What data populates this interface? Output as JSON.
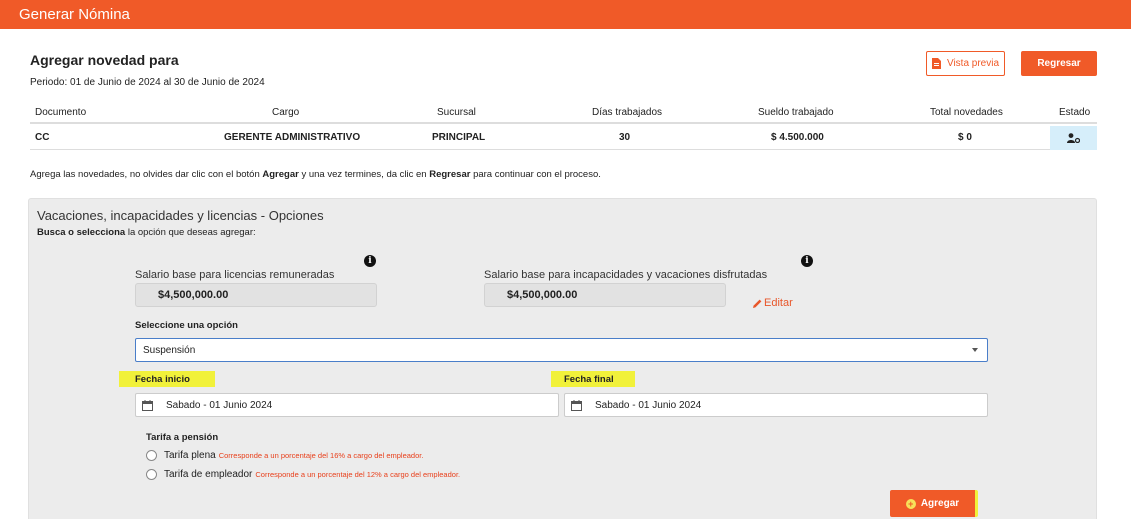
{
  "header": {
    "title": "Generar Nómina"
  },
  "page": {
    "title": "Agregar novedad para",
    "period": "Periodo: 01 de Junio de 2024 al 30 de Junio de 2024"
  },
  "toolbar": {
    "preview_label": "Vista previa",
    "back_label": "Regresar"
  },
  "table": {
    "columns": {
      "documento": "Documento",
      "cargo": "Cargo",
      "sucursal": "Sucursal",
      "dias": "Días trabajados",
      "sueldo": "Sueldo trabajado",
      "novedades": "Total novedades",
      "estado": "Estado"
    },
    "row": {
      "documento": "CC",
      "cargo": "GERENTE ADMINISTRATIVO",
      "sucursal": "PRINCIPAL",
      "dias": "30",
      "sueldo": "$ 4.500.000",
      "novedades": "$ 0"
    }
  },
  "hint": {
    "part1": "Agrega las novedades, no olvides dar clic con el botón ",
    "bold1": "Agregar",
    "part2": " y una vez termines, da clic en ",
    "bold2": "Regresar",
    "part3": " para continuar con el proceso."
  },
  "panel": {
    "title": "Vacaciones, incapacidades y licencias - Opciones",
    "sub_bold": "Busca o selecciona",
    "sub_rest": " la opción que deseas agregar:",
    "salary_licencias_label": "Salario base para licencias remuneradas",
    "salary_licencias_value": "$4,500,000.00",
    "salary_incap_label": "Salario base para incapacidades y vacaciones disfrutadas",
    "salary_incap_value": "$4,500,000.00",
    "edit_label": "Editar",
    "select_label": "Seleccione una opción",
    "select_value": "Suspensión",
    "fecha_inicio_label": "Fecha inicio",
    "fecha_inicio_value": "Sabado - 01 Junio 2024",
    "fecha_final_label": "Fecha final",
    "fecha_final_value": "Sabado - 01 Junio 2024",
    "tarifa_label": "Tarifa a pensión",
    "tarifa_plena_label": "Tarifa plena",
    "tarifa_plena_note": "Corresponde a un porcentaje del 16% a cargo del empleador.",
    "tarifa_empleador_label": "Tarifa de empleador",
    "tarifa_empleador_note": "Corresponde a un porcentaje del 12% a cargo del empleador.",
    "add_label": "Agregar"
  },
  "colors": {
    "accent": "#f05a28",
    "highlight": "#f1f13a",
    "status_bg": "#d6eefa"
  }
}
